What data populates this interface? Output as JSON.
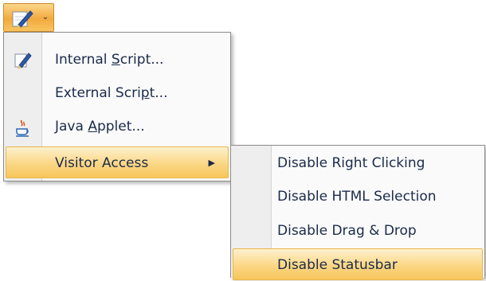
{
  "toolbar": {
    "button_icon": "pen-icon",
    "dropdown_icon": "chevron-down-icon",
    "dropdown_glyph": "⌄"
  },
  "menu": {
    "items": [
      {
        "pre": "Internal ",
        "ul": "S",
        "post": "cript...",
        "icon": "pen-icon"
      },
      {
        "pre": "External Scri",
        "ul": "p",
        "post": "t...",
        "icon": ""
      },
      {
        "pre": "Java ",
        "ul": "A",
        "post": "pplet...",
        "icon": "java-icon"
      },
      {
        "label": "Visitor Access",
        "submenu_glyph": "▶"
      }
    ]
  },
  "submenu": {
    "items": [
      {
        "label": "Disable Right Clicking"
      },
      {
        "label": "Disable HTML Selection"
      },
      {
        "label": "Disable Drag & Drop"
      },
      {
        "label": "Disable Statusbar"
      }
    ]
  },
  "colors": {
    "highlight": "#fbd98a",
    "text": "#1b2a4a"
  }
}
